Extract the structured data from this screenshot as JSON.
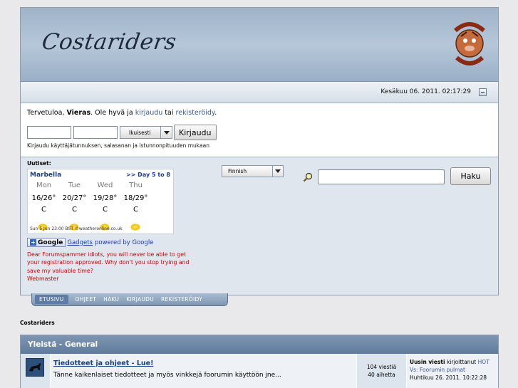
{
  "header": {
    "logo_text": "Costariders",
    "badge_top": "COSTA RIDERS",
    "badge_bottom": "ESPAÑA",
    "date": "Kesäkuu 06. 2011. 02:17:29"
  },
  "userbox": {
    "welcome_prefix": "Tervetuloa, ",
    "guest": "Vieras",
    "welcome_mid": ". Ole hyvä ja ",
    "login_link": "kirjaudu",
    "or": " tai ",
    "register_link": "rekisteröidy",
    "end": ".",
    "duration_value": "Ikuisesti",
    "login_button": "Kirjaudu",
    "hint": "Kirjaudu käyttäjätunnuksen, salasanan ja istunnonpituuden mukaan"
  },
  "news": {
    "label": "Uutiset:",
    "weather": {
      "location": "Marbella",
      "more": ">> Day 5 to 8",
      "days": [
        "Mon",
        "Tue",
        "Wed",
        "Thu"
      ],
      "temps": [
        "16/26°",
        "20/27°",
        "19/28°",
        "18/29°"
      ],
      "units": [
        "C",
        "C",
        "C",
        "C"
      ],
      "footer": "Sun 5 Jun 23:00 BST  ©weatheronline.co.uk"
    },
    "gadgets_word": "Google",
    "gadgets_link": "Gadgets",
    "gadgets_suffix": "powered by Google",
    "spam_lines": [
      "Dear Forumspammer idiots, you will never be able to get",
      "your registration approved. Why don't you stop trying and",
      "save my valuable time?",
      "Webmaster"
    ]
  },
  "language": {
    "value": "Finnish"
  },
  "search": {
    "button": "Haku"
  },
  "menu": [
    "ETUSIVU",
    "OHJEET",
    "HAKU",
    "KIRJAUDU",
    "REKISTERÖIDY"
  ],
  "breadcrumb": "Costariders",
  "category": {
    "title": "Yleistä - General",
    "board": {
      "title": "Tiedotteet ja ohjeet - Lue!",
      "description": "Tänne kaikenlaiset tiedotteet ja myös vinkkejä foorumin käyttöön jne...",
      "posts": "104 viestiä",
      "topics": "40 aihetta",
      "last_prefix": "Uusin viesti",
      "last_by": " kirjoittanut ",
      "last_author": "HOT",
      "last_topic": "Vs: Foorumin pulmat",
      "last_date": "Huhtikuu 26. 2011. 10:22:28"
    }
  },
  "colors": {
    "header": "#b6c7d9",
    "category_header": "#6e88a7",
    "spam_text": "#d10000",
    "link": "#3b5998"
  }
}
